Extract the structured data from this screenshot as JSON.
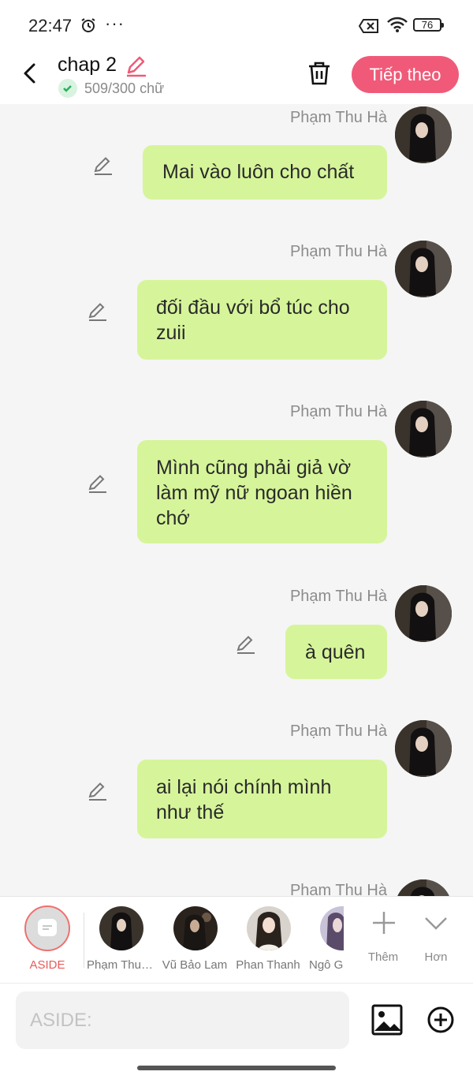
{
  "status_bar": {
    "time": "22:47",
    "dots": "···",
    "battery": "76"
  },
  "header": {
    "title": "chap 2",
    "word_count": "509/300 chữ",
    "next_label": "Tiếp theo",
    "accent_color": "#f05a78"
  },
  "messages": [
    {
      "sender": "Phạm Thu Hà",
      "text": "Mai vào luôn cho chất"
    },
    {
      "sender": "Phạm Thu Hà",
      "text": "đối đầu với bổ túc cho zuii"
    },
    {
      "sender": "Phạm Thu Hà",
      "text": "Mình cũng phải giả vờ làm mỹ nữ ngoan hiền chớ"
    },
    {
      "sender": "Phạm Thu Hà",
      "text": "à quên"
    },
    {
      "sender": "Phạm Thu Hà",
      "text": "ai lại nói chính mình như thế"
    },
    {
      "sender": "Phạm Thu Hà",
      "text": ""
    }
  ],
  "characters": {
    "aside_label": "ASIDE",
    "items": [
      {
        "name": "Phạm Thu Hà"
      },
      {
        "name": "Vũ Bảo Lam"
      },
      {
        "name": "Phan Thanh"
      },
      {
        "name": "Ngô G"
      }
    ],
    "more_label": "Thêm",
    "expand_label": "Hơn"
  },
  "composer": {
    "placeholder": "ASIDE:"
  }
}
